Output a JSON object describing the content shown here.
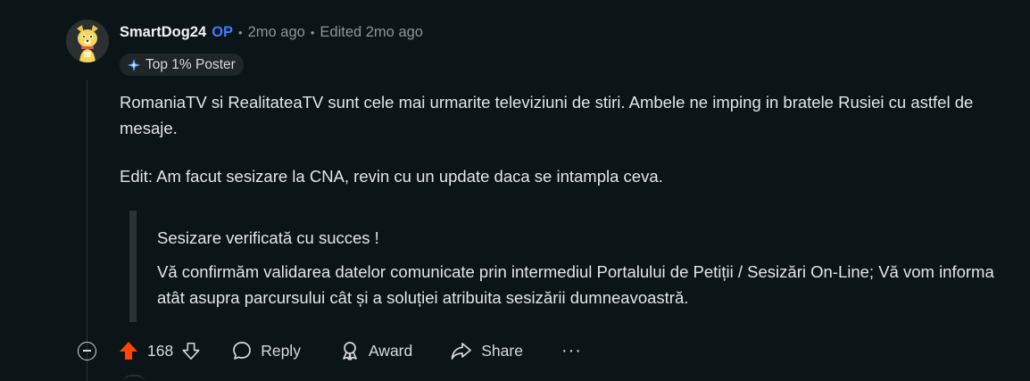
{
  "comment": {
    "author": "SmartDog24",
    "op_label": "OP",
    "posted": "2mo ago",
    "edited": "Edited 2mo ago",
    "flair": "Top 1% Poster",
    "text": "RomaniaTV si RealitateaTV sunt cele mai urmarite televiziuni de stiri. Ambele ne imping in bratele Rusiei cu astfel de mesaje.",
    "edit_text": "Edit: Am facut sesizare la CNA, revin cu un update daca se intampla ceva.",
    "quote": {
      "line1": "Sesizare verificată cu succes !",
      "line2": "Vă confirmăm validarea datelor comunicate prin intermediul Portalului de Petiții / Sesizări On-Line; Vă vom informa atât asupra parcursului cât și a soluției atribuita sesizării dumneavoastră."
    }
  },
  "actions": {
    "score": "168",
    "reply": "Reply",
    "award": "Award",
    "share": "Share",
    "more": "···"
  },
  "colors": {
    "background": "#0b1416",
    "op": "#3d7cff",
    "upvote": "#ff4500",
    "meta": "#8b979c"
  },
  "icons": [
    "avatar-dog-icon",
    "flair-sparkle-icon",
    "collapse-icon",
    "upvote-icon",
    "downvote-icon",
    "reply-icon",
    "award-icon",
    "share-icon",
    "more-icon"
  ]
}
